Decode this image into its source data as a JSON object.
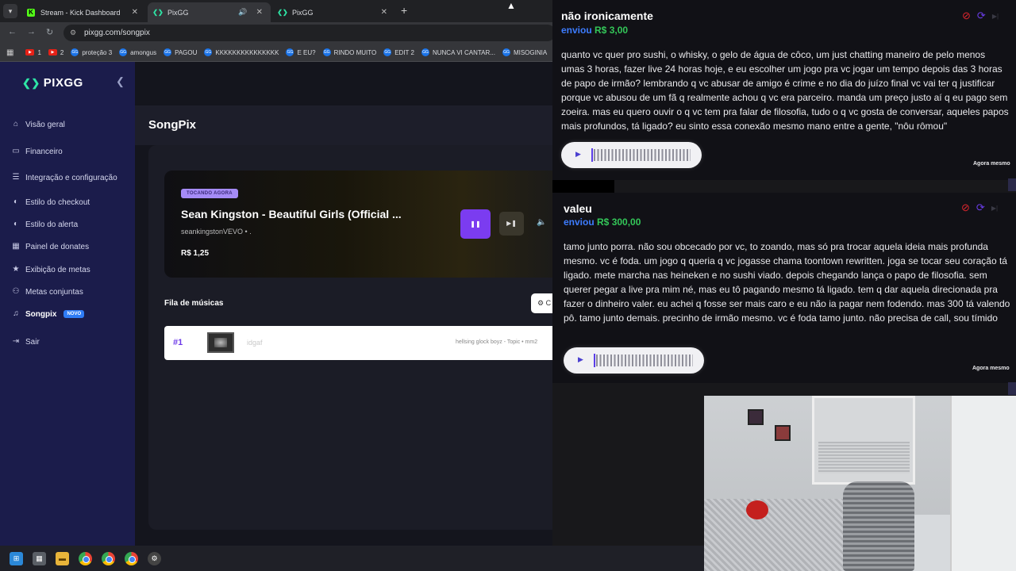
{
  "browser": {
    "tabs": [
      {
        "title": "Stream - Kick Dashboard",
        "icon": "kick-icon",
        "active": false
      },
      {
        "title": "PixGG",
        "icon": "pixgg-icon",
        "active": true,
        "audio": true
      },
      {
        "title": "PixGG",
        "icon": "pixgg-icon",
        "active": false
      }
    ],
    "new_tab": "+",
    "url": "pixgg.com/songpix",
    "bookmarks": [
      "1",
      "2",
      "proteção 3",
      "amongus",
      "PAGOU",
      "KKKKKKKKKKKKKKK",
      "E EU?",
      "RINDO MUITO",
      "EDIT 2",
      "NUNCA VI CANTAR...",
      "MISOGINIA"
    ]
  },
  "sidebar": {
    "logo": "PIXGG",
    "items": [
      {
        "label": "Visão geral",
        "icon": "home-icon",
        "glyph": "⌂"
      },
      {
        "label": "Financeiro",
        "icon": "wallet-icon",
        "glyph": "▭"
      },
      {
        "label": "Integração e configuração",
        "icon": "list-icon",
        "glyph": "☰"
      },
      {
        "label": "Estilo do checkout",
        "icon": "palette-icon",
        "glyph": "◐"
      },
      {
        "label": "Estilo do alerta",
        "icon": "palette-icon",
        "glyph": "◐"
      },
      {
        "label": "Painel de donates",
        "icon": "grid-icon",
        "glyph": "▦"
      },
      {
        "label": "Exibição de metas",
        "icon": "star-icon",
        "glyph": "★"
      },
      {
        "label": "Metas conjuntas",
        "icon": "group-icon",
        "glyph": "⚇"
      },
      {
        "label": "Songpix",
        "icon": "music-icon",
        "glyph": "♫",
        "badge": "NOVO"
      },
      {
        "label": "Sair",
        "icon": "logout-icon",
        "glyph": "⇥"
      }
    ]
  },
  "main": {
    "title": "SongPix",
    "now_playing": {
      "badge": "TOCANDO AGORA",
      "title": "Sean Kingston - Beautiful Girls (Official ...",
      "channel": "seankingstonVEVO • .",
      "price": "R$ 1,25"
    },
    "queue_label": "Fila de músicas",
    "queue_button": "⚙ C",
    "queue": [
      {
        "num": "#1",
        "title": "idgaf",
        "artist": "hellsing glock boyz - Topic • mm2"
      }
    ]
  },
  "alerts": [
    {
      "name": "não ironicamente",
      "sent_label": "enviou",
      "amount": "R$ 3,00",
      "message": "quanto vc quer pro sushi, o whisky, o gelo de água de côco, um just chatting maneiro de pelo menos umas 3 horas, fazer live 24 horas hoje, e eu escolher um jogo pra vc jogar um tempo depois das 3 horas de papo de irmão? lembrando q vc abusar de amigo é crime e no dia do juízo final vc vai ter q justificar porque vc abusou de um fã q realmente achou q vc era parceiro. manda um preço justo aí q eu pago sem zoeira. mas eu quero ouvir o q vc tem pra falar de filosofia, tudo o q vc gosta de conversar, aqueles papos mais profundos, tá ligado? eu sinto essa conexão mesmo mano entre a gente, \"nôu rômou\"",
      "time": "Agora mesmo"
    },
    {
      "name": "valeu",
      "sent_label": "enviou",
      "amount": "R$ 300,00",
      "message": "tamo junto porra. não sou obcecado por vc, to zoando, mas só pra trocar aquela ideia mais profunda mesmo. vc é foda. um jogo q queria q vc jogasse chama toontown rewritten. joga se tocar seu coração tá ligado. mete marcha nas heineken e no sushi viado. depois chegando lança o papo de filosofia. sem querer pegar a live pra mim né, mas eu tô pagando mesmo tá ligado. tem q dar aquela direcionada pra fazer o dinheiro valer. eu achei q fosse ser mais caro e eu não ia pagar nem fodendo. mas 300 tá valendo pô. tamo junto demais. precinho de irmão mesmo. vc é foda tamo junto. não precisa de call, sou tímido",
      "time": "Agora mesmo"
    }
  ],
  "colors": {
    "accent": "#7b3cf0",
    "sidebar": "#1b1c4b",
    "amount": "#34c759",
    "sent": "#3d7cff",
    "ban": "#e0262e"
  }
}
